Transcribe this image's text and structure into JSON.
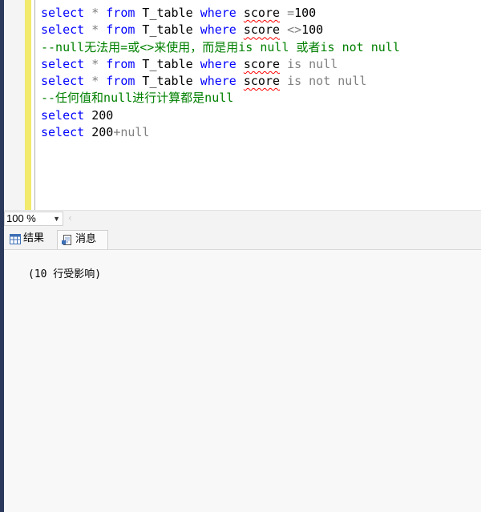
{
  "editor": {
    "lines": [
      [
        {
          "t": "select",
          "c": "kw"
        },
        {
          "t": " "
        },
        {
          "t": "*",
          "c": "op"
        },
        {
          "t": " "
        },
        {
          "t": "from",
          "c": "kw"
        },
        {
          "t": " T_table "
        },
        {
          "t": "where",
          "c": "kw"
        },
        {
          "t": " "
        },
        {
          "t": "score",
          "c": "squig"
        },
        {
          "t": " "
        },
        {
          "t": "=",
          "c": "op"
        },
        {
          "t": "100"
        }
      ],
      [
        {
          "t": "select",
          "c": "kw"
        },
        {
          "t": " "
        },
        {
          "t": "*",
          "c": "op"
        },
        {
          "t": " "
        },
        {
          "t": "from",
          "c": "kw"
        },
        {
          "t": " T_table "
        },
        {
          "t": "where",
          "c": "kw"
        },
        {
          "t": " "
        },
        {
          "t": "score",
          "c": "squig"
        },
        {
          "t": " "
        },
        {
          "t": "<>",
          "c": "op"
        },
        {
          "t": "100"
        }
      ],
      [
        {
          "t": "--null无法用=或<>来使用，而是用is null 或者is not null",
          "c": "cm"
        }
      ],
      [
        {
          "t": "select",
          "c": "kw"
        },
        {
          "t": " "
        },
        {
          "t": "*",
          "c": "op"
        },
        {
          "t": " "
        },
        {
          "t": "from",
          "c": "kw"
        },
        {
          "t": " T_table "
        },
        {
          "t": "where",
          "c": "kw"
        },
        {
          "t": " "
        },
        {
          "t": "score",
          "c": "squig"
        },
        {
          "t": " "
        },
        {
          "t": "is null",
          "c": "gy"
        }
      ],
      [
        {
          "t": "select",
          "c": "kw"
        },
        {
          "t": " "
        },
        {
          "t": "*",
          "c": "op"
        },
        {
          "t": " "
        },
        {
          "t": "from",
          "c": "kw"
        },
        {
          "t": " T_table "
        },
        {
          "t": "where",
          "c": "kw"
        },
        {
          "t": " "
        },
        {
          "t": "score",
          "c": "squig"
        },
        {
          "t": " "
        },
        {
          "t": "is not null",
          "c": "gy"
        }
      ],
      [
        {
          "t": "--任何值和null进行计算都是null",
          "c": "cm"
        }
      ],
      [
        {
          "t": "select",
          "c": "kw"
        },
        {
          "t": " 200"
        }
      ],
      [
        {
          "t": "select",
          "c": "kw"
        },
        {
          "t": " 200"
        },
        {
          "t": "+null",
          "c": "gy"
        }
      ]
    ]
  },
  "zoom": {
    "value": "100 %"
  },
  "tabs": {
    "results": "结果",
    "messages": "消息"
  },
  "messages": {
    "text": "(10 行受影响)"
  },
  "icons": {
    "zoom_dropdown": "chevron-down-icon",
    "scroll_left": "scroll-left-arrow-icon",
    "results_tab": "grid-icon",
    "messages_tab": "document-icon"
  },
  "colors": {
    "keyword": "#0000ff",
    "comment": "#008000",
    "operator": "#808080",
    "squiggle": "#ff0000"
  }
}
